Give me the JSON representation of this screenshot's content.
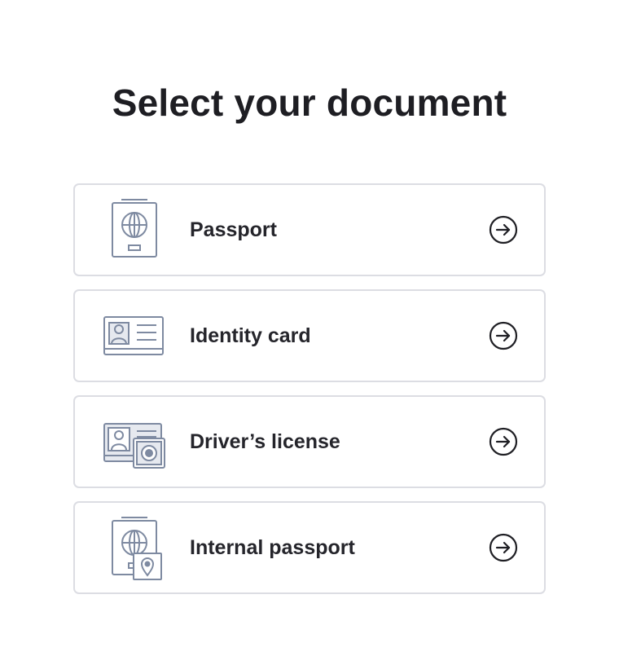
{
  "page": {
    "title": "Select your document"
  },
  "documents": [
    {
      "label": "Passport",
      "icon": "passport-icon"
    },
    {
      "label": "Identity card",
      "icon": "identity-card-icon"
    },
    {
      "label": "Driver’s license",
      "icon": "drivers-license-icon"
    },
    {
      "label": "Internal passport",
      "icon": "internal-passport-icon"
    }
  ],
  "colors": {
    "icon_stroke": "#7e8aa1",
    "icon_fill": "#e6e9ef",
    "card_border": "#dcdde3",
    "text": "#1f1f24"
  }
}
